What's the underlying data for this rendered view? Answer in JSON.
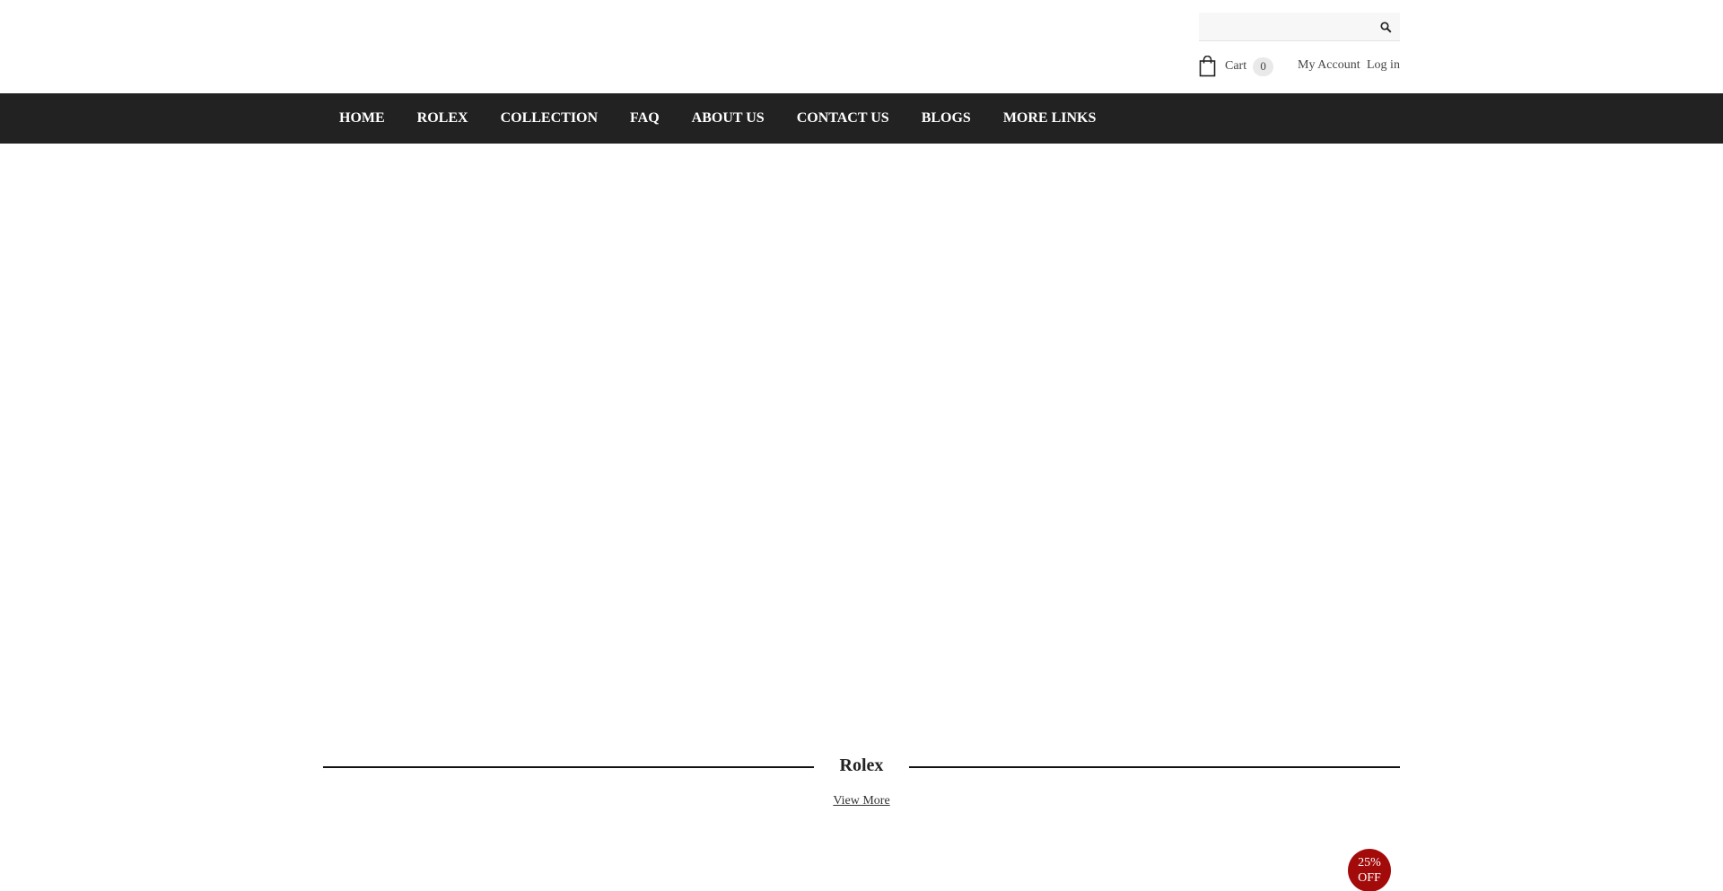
{
  "header": {
    "search": {
      "value": "",
      "placeholder": ""
    },
    "cart": {
      "label": "Cart",
      "count": "0"
    },
    "my_account": "My Account",
    "login": "Log in"
  },
  "nav": {
    "items": [
      {
        "label": "HOME"
      },
      {
        "label": "ROLEX"
      },
      {
        "label": "COLLECTION"
      },
      {
        "label": "FAQ"
      },
      {
        "label": "ABOUT US"
      },
      {
        "label": "CONTACT US"
      },
      {
        "label": "BLOGS"
      },
      {
        "label": "MORE LINKS"
      }
    ]
  },
  "section": {
    "title": "Rolex",
    "view_more": "View More"
  },
  "badge": {
    "line1": "25%",
    "line2": "OFF"
  },
  "colors": {
    "nav_bg": "#222222",
    "sale_badge": "#a30b0b"
  },
  "icons": {
    "search": "search-icon",
    "cart": "shopping-bag-icon"
  }
}
